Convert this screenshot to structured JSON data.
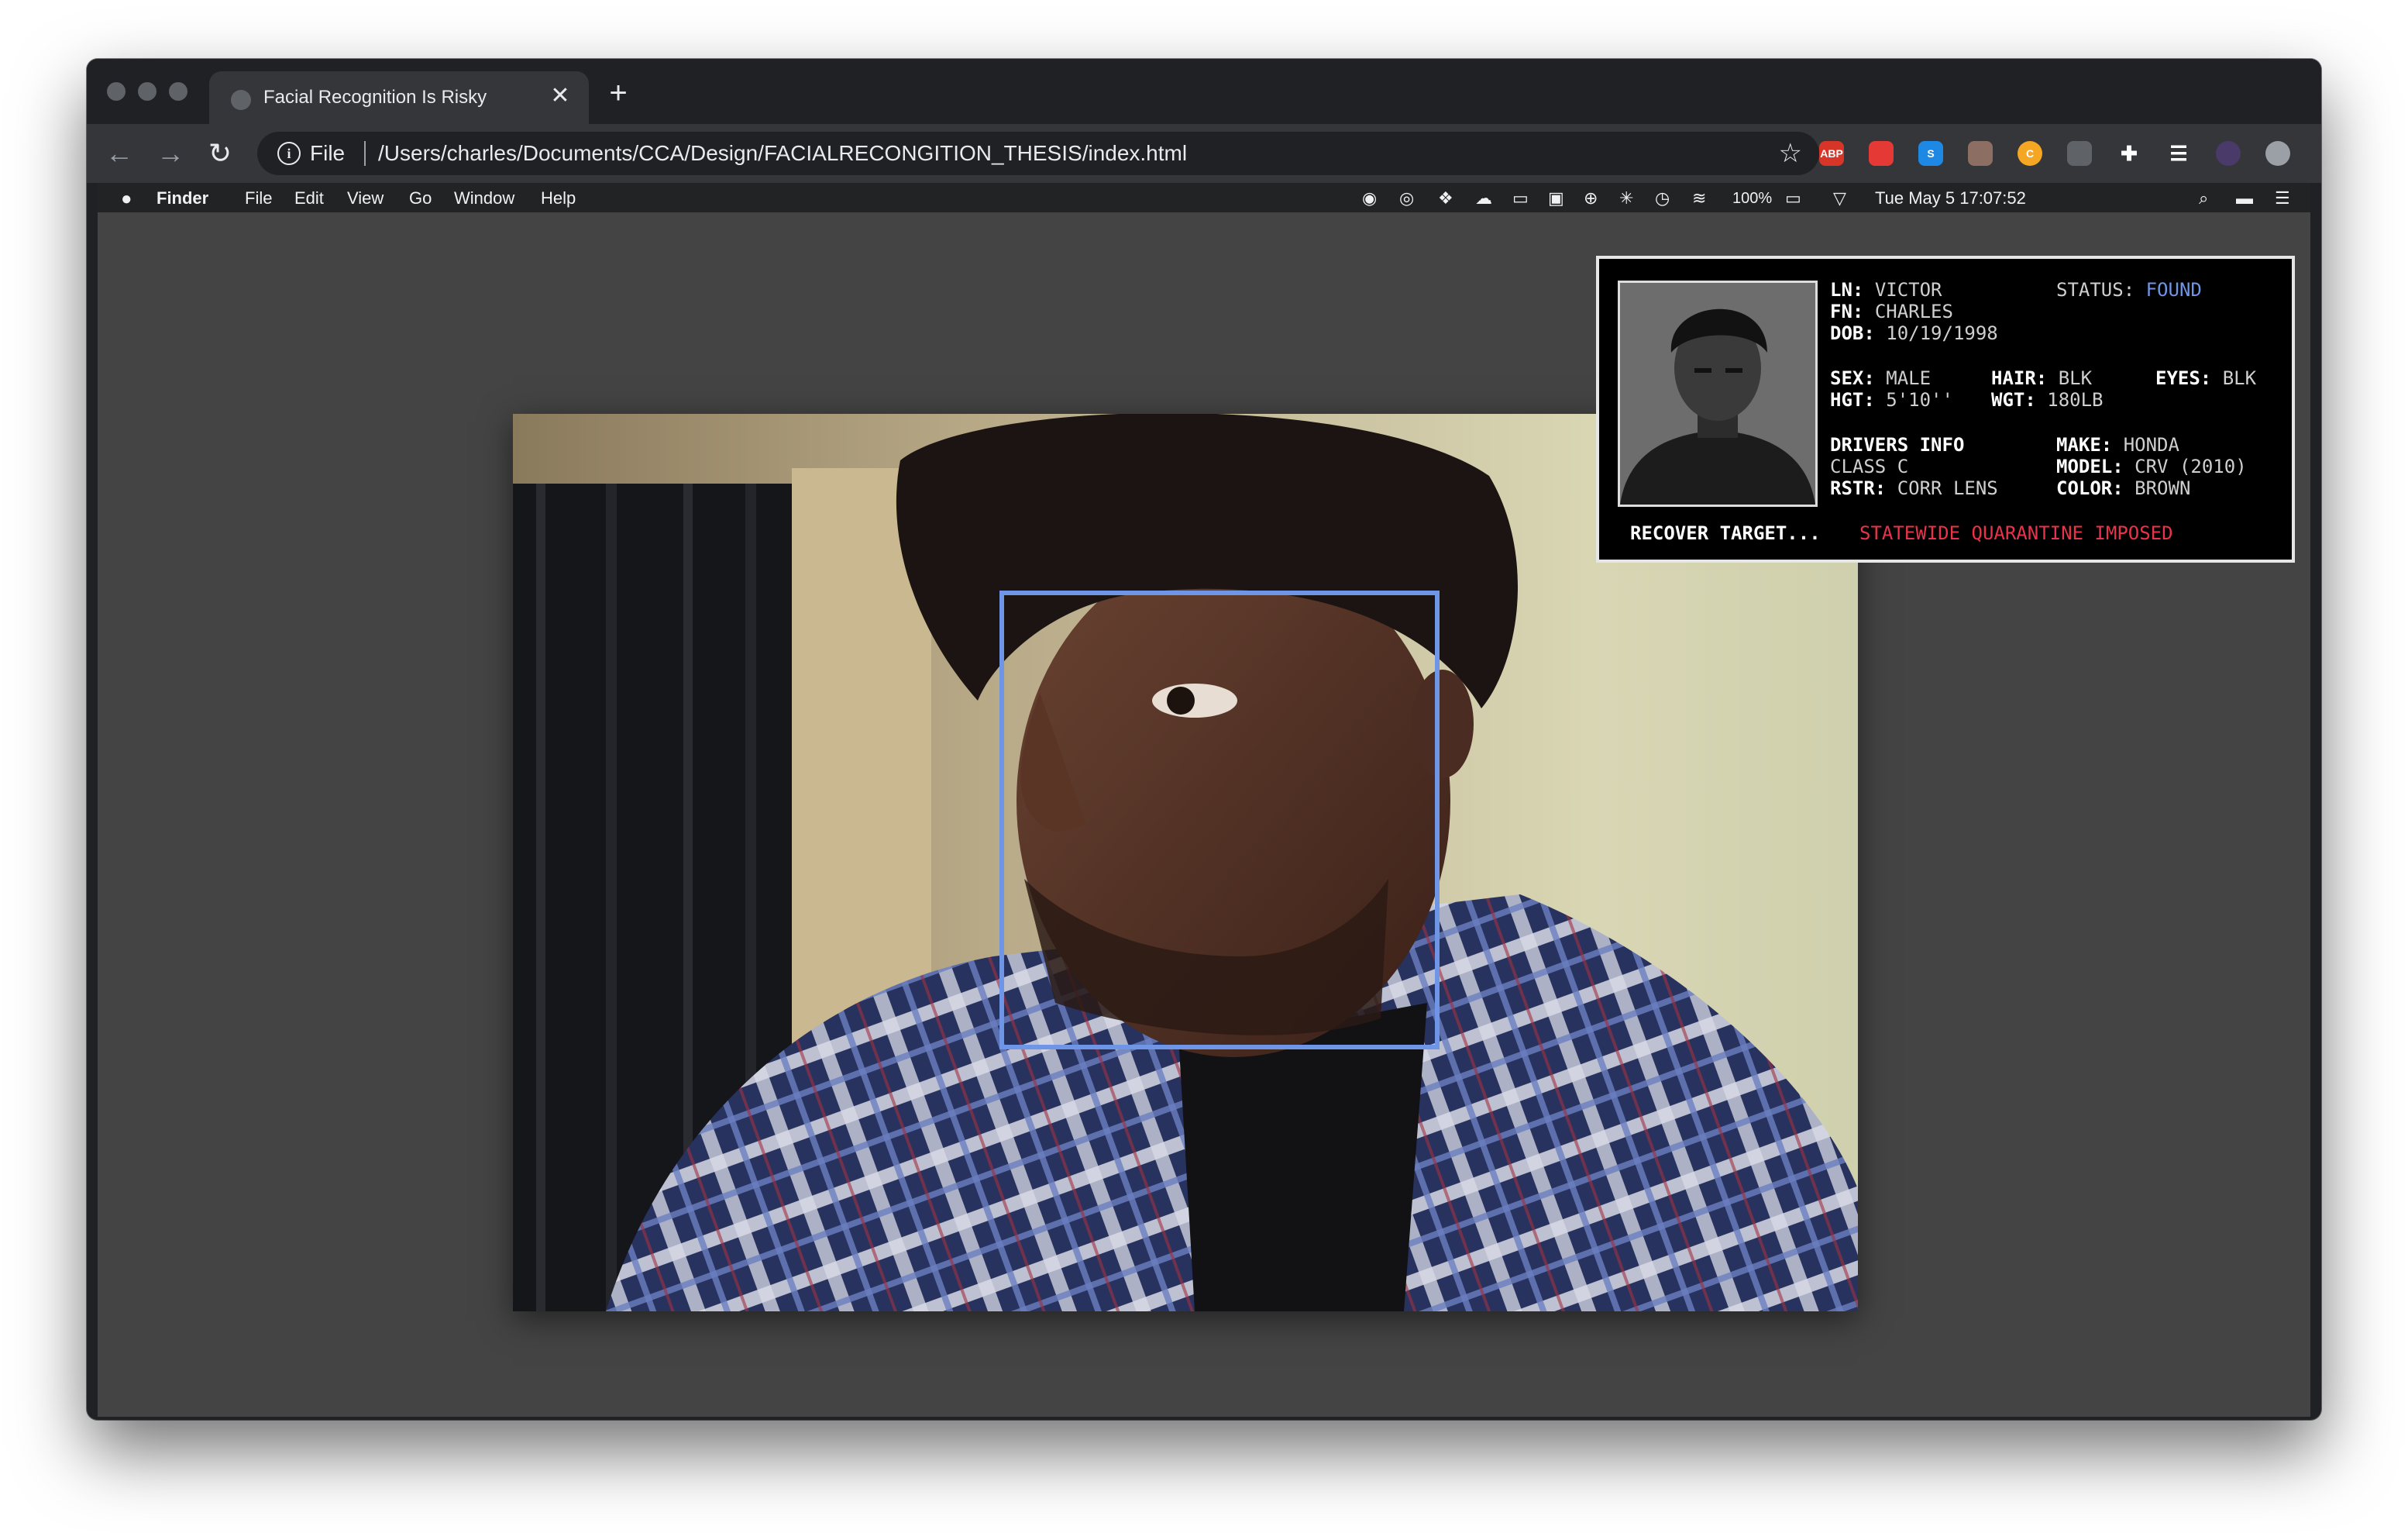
{
  "browser": {
    "tab_title": "Facial Recognition Is Risky",
    "tab_close": "✕",
    "new_tab": "+",
    "scheme": "File",
    "url": "/Users/charles/Documents/CCA/Design/FACIALRECONGITION_THESIS/index.html",
    "back": "←",
    "forward": "→",
    "reload": "↻",
    "star": "☆",
    "extensions": [
      {
        "icon": "adblock-plus-icon",
        "label": "ABP",
        "color": "#d73527"
      },
      {
        "icon": "ublock-icon",
        "label": "",
        "color": "#e53935"
      },
      {
        "icon": "s-extension-icon",
        "label": "S",
        "color": "#1e88e5"
      },
      {
        "icon": "sunglasses-extension-icon",
        "label": "",
        "color": "#8d6e63"
      },
      {
        "icon": "coin-extension-icon",
        "label": "C",
        "color": "#f5a623"
      },
      {
        "icon": "hand-extension-icon",
        "label": "",
        "color": "#5f6368"
      },
      {
        "icon": "puzzle-extensions-icon",
        "label": "",
        "color": "#35363a"
      },
      {
        "icon": "media-playlist-icon",
        "label": "",
        "color": "#35363a"
      },
      {
        "icon": "profile-avatar-icon",
        "label": "",
        "color": "#4a3a6a"
      },
      {
        "icon": "update-icon",
        "label": "",
        "color": "#9aa0a6"
      }
    ]
  },
  "mac_menubar": {
    "apple": "",
    "app": "Finder",
    "menus": [
      "File",
      "Edit",
      "View",
      "Go",
      "Window",
      "Help"
    ],
    "battery": "100%",
    "datetime": "Tue May 5  17:07:52"
  },
  "profile_card": {
    "ln_label": "LN:",
    "ln_value": "VICTOR",
    "status_label": "STATUS:",
    "status_value": "FOUND",
    "fn_label": "FN:",
    "fn_value": "CHARLES",
    "dob_label": "DOB:",
    "dob_value": "10/19/1998",
    "sex_label": "SEX:",
    "sex_value": "MALE",
    "hair_label": "HAIR:",
    "hair_value": "BLK",
    "eyes_label": "EYES:",
    "eyes_value": "BLK",
    "hgt_label": "HGT:",
    "hgt_value": "5'10''",
    "wgt_label": "WGT:",
    "wgt_value": "180LB",
    "drivers_label": "DRIVERS INFO",
    "make_label": "MAKE:",
    "make_value": "HONDA",
    "class_label": "CLASS",
    "class_value": "C",
    "model_label": "MODEL:",
    "model_value": "CRV (2010)",
    "rstr_label": "RSTR:",
    "rstr_value": "CORR LENS",
    "color_label": "COLOR:",
    "color_value": "BROWN",
    "recover": "RECOVER TARGET...",
    "alert": "STATEWIDE QUARANTINE IMPOSED"
  },
  "colors": {
    "face_box": "#6f95e6",
    "status_found": "#6f95e6",
    "alert": "#e8334a",
    "page_background": "#444444"
  }
}
